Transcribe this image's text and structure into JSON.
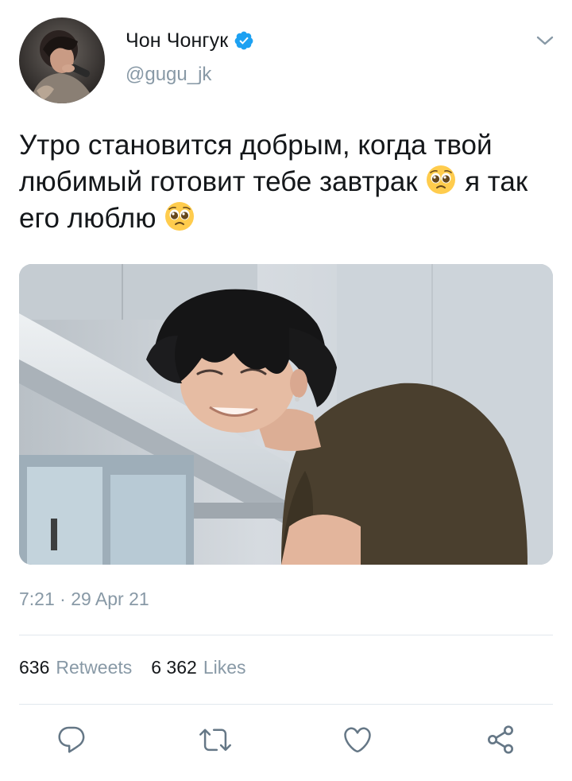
{
  "user": {
    "display_name": "Чон Чонгук",
    "handle": "@gugu_jk",
    "verified_icon": "verified-badge-icon"
  },
  "tweet": {
    "text_part1": "Утро становится добрым, когда твой любимый готовит тебе завтрак ",
    "text_part2": " я так его люблю ",
    "emoji_name": "pleading-face-emoji",
    "timestamp": "7:21 · 29 Apr 21"
  },
  "stats": {
    "retweets_count": "636",
    "retweets_label": "Retweets",
    "likes_count": "6 362",
    "likes_label": "Likes"
  },
  "actions": {
    "reply_icon": "reply-icon",
    "retweet_icon": "retweet-icon",
    "like_icon": "heart-icon",
    "share_icon": "share-icon"
  },
  "colors": {
    "text": "#14171a",
    "muted": "#8899a6",
    "verified": "#1da1f2",
    "divider": "#e1e8ed"
  }
}
